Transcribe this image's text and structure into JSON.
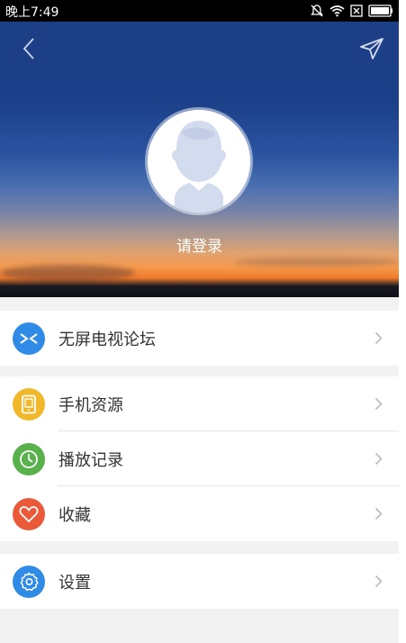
{
  "status_bar": {
    "time": "晚上7:49"
  },
  "header": {
    "back_icon": "chevron-left-icon",
    "send_icon": "send-icon",
    "avatar_icon": "user-avatar-icon",
    "login_label": "请登录"
  },
  "menu": {
    "group1": [
      {
        "label": "无屏电视论坛",
        "icon": "forum-icon",
        "color": "#2f8be6"
      }
    ],
    "group2": [
      {
        "label": "手机资源",
        "icon": "tablet-icon",
        "color": "#f0b82a"
      },
      {
        "label": "播放记录",
        "icon": "clock-icon",
        "color": "#58b14a"
      },
      {
        "label": "收藏",
        "icon": "heart-icon",
        "color": "#ea5a3a"
      }
    ],
    "group3": [
      {
        "label": "设置",
        "icon": "gear-icon",
        "color": "#2f8be6"
      }
    ]
  },
  "colors": {
    "background": "#f2f2f2",
    "text": "#333333",
    "chevron": "#bbbbbb"
  }
}
